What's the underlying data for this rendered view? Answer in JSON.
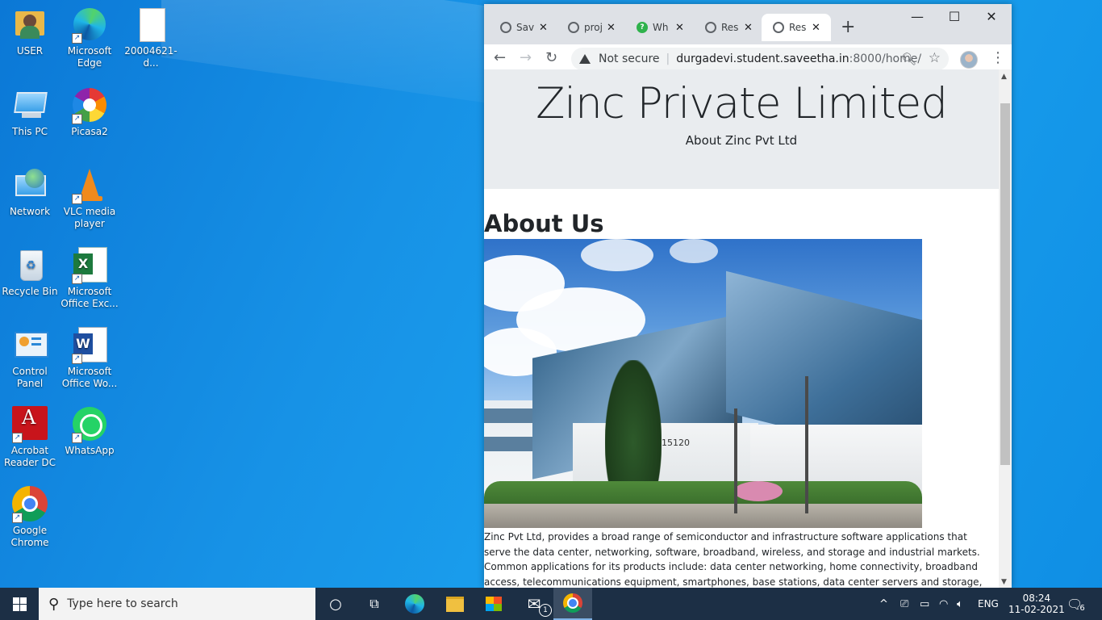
{
  "desktop": {
    "icons": [
      {
        "label": "USER"
      },
      {
        "label": "Microsoft Edge"
      },
      {
        "label": "20004621-d..."
      },
      {
        "label": "This PC"
      },
      {
        "label": "Picasa2"
      },
      {
        "label": "Network"
      },
      {
        "label": "VLC media player"
      },
      {
        "label": "Recycle Bin"
      },
      {
        "label": "Microsoft Office Exc..."
      },
      {
        "label": "Control Panel"
      },
      {
        "label": "Microsoft Office Wo..."
      },
      {
        "label": "Acrobat Reader DC"
      },
      {
        "label": "WhatsApp"
      },
      {
        "label": "Google Chrome"
      }
    ]
  },
  "browser": {
    "tabs": [
      {
        "title": "Save",
        "icon": "globe-icon"
      },
      {
        "title": "proj",
        "icon": "globe-icon"
      },
      {
        "title": "Wh",
        "icon": "whatsapp-icon"
      },
      {
        "title": "Resp",
        "icon": "globe-icon"
      },
      {
        "title": "Resp",
        "icon": "globe-icon",
        "active": true
      }
    ],
    "new_tab": "+",
    "address": {
      "security": "Not secure",
      "host": "durgadevi.student.saveetha.in",
      "rest": ":8000/home/"
    }
  },
  "page": {
    "title": "Zinc Private Limited",
    "subtitle": "About Zinc Pvt Ltd",
    "heading": "About Us",
    "photo_text": "15120",
    "paragraph": "Zinc Pvt Ltd, provides a broad range of semiconductor and infrastructure software applications that serve the data center, networking, software, broadband, wireless, and storage and industrial markets. Common applications for its products include: data center networking, home connectivity, broadband access, telecommunications equipment, smartphones, base stations, data center servers and storage, factory automation, power generation and alternative"
  },
  "taskbar": {
    "search_placeholder": "Type here to search",
    "mail_badge": "1",
    "language": "ENG",
    "time": "08:24",
    "date": "11-02-2021",
    "notification_count": "6"
  },
  "colors": {
    "desktop": "#1792e6",
    "taskbar": "#1c2f45",
    "jumbotron": "#e9ecef"
  }
}
